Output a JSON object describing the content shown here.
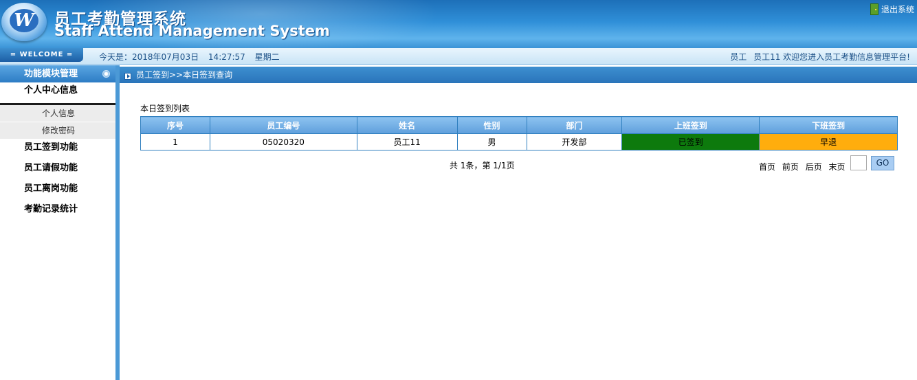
{
  "header": {
    "title_cn": "员工考勤管理系统",
    "title_en": "Staff Attend Management System",
    "logout_label": "退出系统",
    "logo_letter": "W"
  },
  "welcome_bar": {
    "badge": "= WELCOME =",
    "today_label": "今天是：2018年07月03日",
    "time": "14:27:57",
    "weekday": "星期二",
    "role": "员工",
    "user_greeting": "员工11 欢迎您进入员工考勤信息管理平台!"
  },
  "sidebar": {
    "heading": "功能模块管理",
    "groups": [
      {
        "label": "个人中心信息",
        "open": true
      },
      {
        "label": "员工签到功能"
      },
      {
        "label": "员工请假功能"
      },
      {
        "label": "员工离岗功能"
      },
      {
        "label": "考勤记录统计"
      }
    ],
    "subitems": [
      "个人信息",
      "修改密码"
    ]
  },
  "main": {
    "breadcrumb": "员工签到>>本日签到查询",
    "list_title": "本日签到列表",
    "columns": [
      "序号",
      "员工编号",
      "姓名",
      "性别",
      "部门",
      "上班签到",
      "下班签到"
    ],
    "rows": [
      {
        "index": "1",
        "employee_no": "05020320",
        "name": "员工11",
        "gender": "男",
        "department": "开发部",
        "checkin": "已签到",
        "checkout": "早退"
      }
    ],
    "status_colors": {
      "checkin": "#0d7a0d",
      "checkout": "#ffad0d"
    },
    "pager": {
      "summary": "共 1条，第 1/1页",
      "first": "首页",
      "prev": "前页",
      "next": "后页",
      "last": "末页",
      "go_label": "GO",
      "page_value": ""
    }
  }
}
